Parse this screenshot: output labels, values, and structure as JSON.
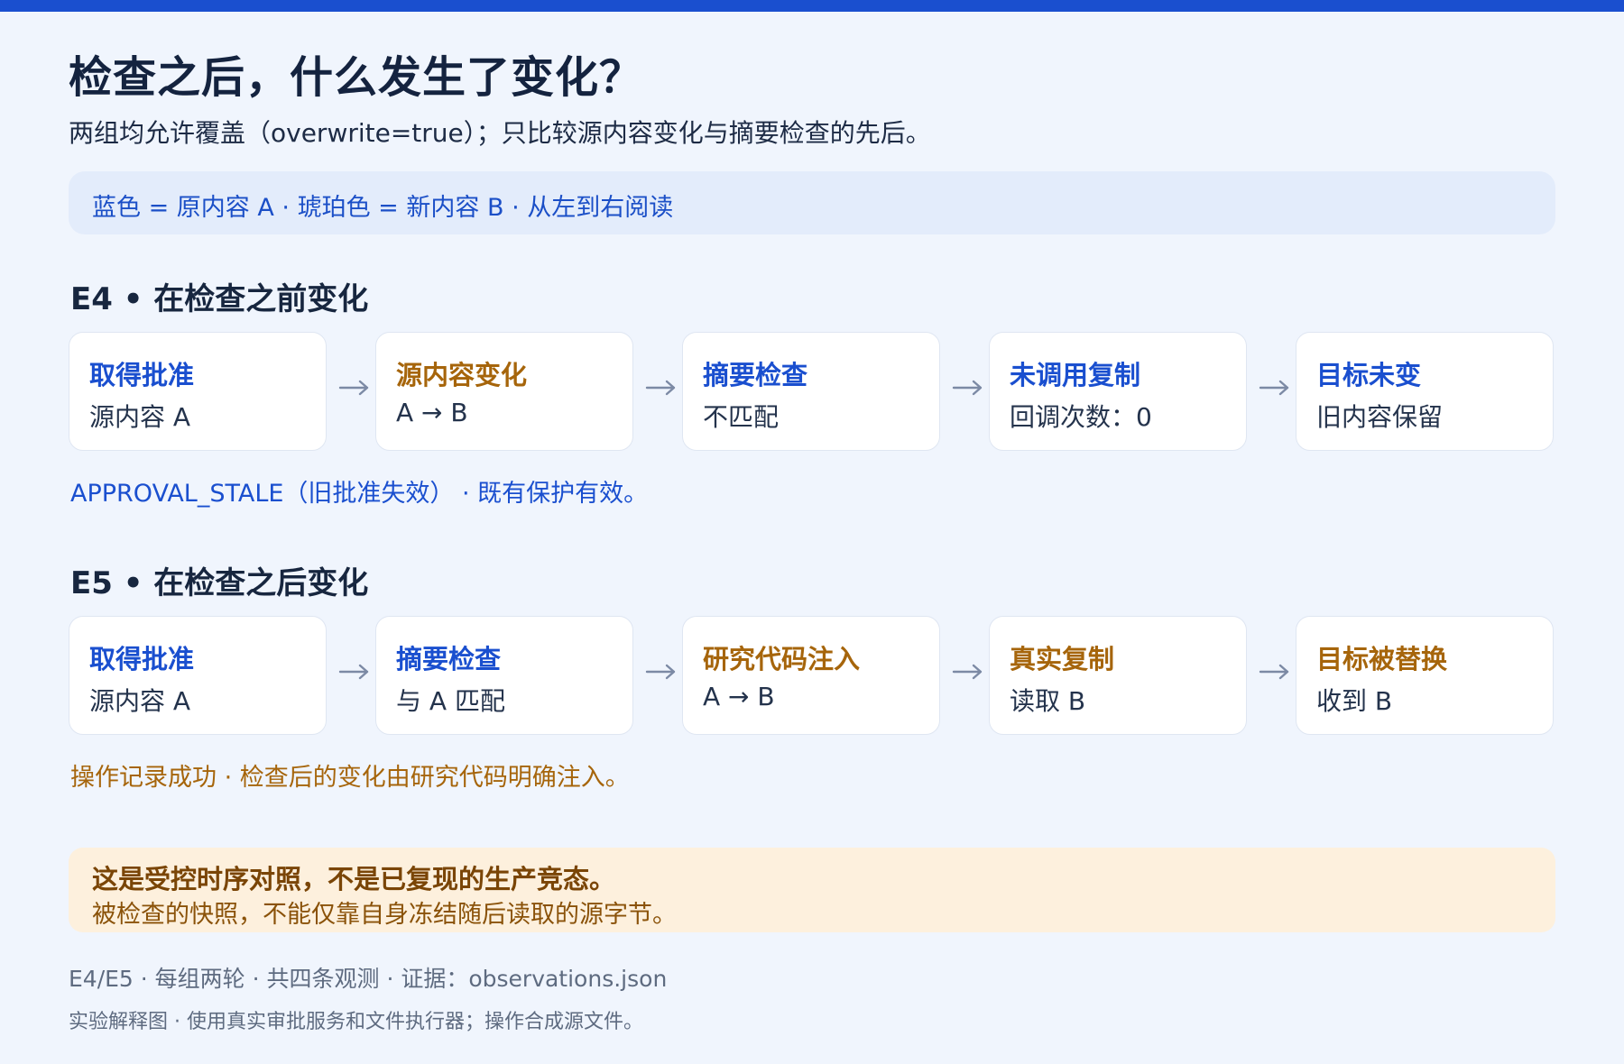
{
  "title": "检查之后，什么发生了变化？",
  "subtitle": "两组均允许覆盖（overwrite=true）；只比较源内容变化与摘要检查的先后。",
  "legend": "蓝色 = 原内容 A · 琥珀色 = 新内容 B · 从左到右阅读",
  "colors": {
    "blue": "#1a4fcf",
    "amber": "#a6650b",
    "arrow": "#7c8aa5"
  },
  "e4": {
    "title": "E4 • 在检查之前变化",
    "steps": [
      {
        "title": "取得批准",
        "text": "源内容 A",
        "tone": "blue"
      },
      {
        "title": "源内容变化",
        "text": "A → B",
        "tone": "amber"
      },
      {
        "title": "摘要检查",
        "text": "不匹配",
        "tone": "blue"
      },
      {
        "title": "未调用复制",
        "text": "回调次数：0",
        "tone": "blue"
      },
      {
        "title": "目标未变",
        "text": "旧内容保留",
        "tone": "blue"
      }
    ],
    "note": "APPROVAL_STALE（旧批准失效） · 既有保护有效。"
  },
  "e5": {
    "title": "E5 • 在检查之后变化",
    "steps": [
      {
        "title": "取得批准",
        "text": "源内容 A",
        "tone": "blue"
      },
      {
        "title": "摘要检查",
        "text": "与 A 匹配",
        "tone": "blue"
      },
      {
        "title": "研究代码注入",
        "text": "A → B",
        "tone": "amber"
      },
      {
        "title": "真实复制",
        "text": "读取 B",
        "tone": "amber"
      },
      {
        "title": "目标被替换",
        "text": "收到 B",
        "tone": "amber"
      }
    ],
    "note": "操作记录成功 · 检查后的变化由研究代码明确注入。"
  },
  "warning": {
    "title": "这是受控时序对照，不是已复现的生产竞态。",
    "text": "被检查的快照，不能仅靠自身冻结随后读取的源字节。"
  },
  "footer": {
    "line1": "E4/E5 · 每组两轮 · 共四条观测 · 证据：observations.json",
    "line2": "实验解释图 · 使用真实审批服务和文件执行器；操作合成源文件。"
  }
}
